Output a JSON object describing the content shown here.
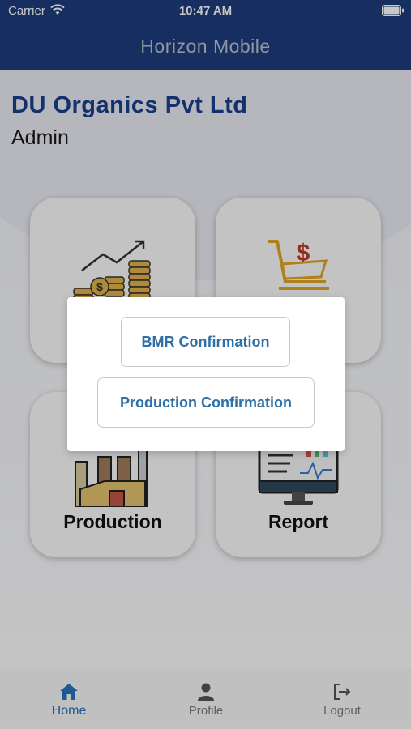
{
  "status_bar": {
    "carrier": "Carrier",
    "time": "10:47 AM"
  },
  "header": {
    "title": "Horizon Mobile"
  },
  "company": {
    "name": "DU Organics Pvt Ltd",
    "role": "Admin"
  },
  "tiles": [
    {
      "label": "",
      "icon": "finance-chart-coins-icon"
    },
    {
      "label": "",
      "icon": "shopping-cart-dollar-icon"
    },
    {
      "label": "Production",
      "icon": "factory-icon"
    },
    {
      "label": "Report",
      "icon": "monitor-report-icon"
    }
  ],
  "dialog": {
    "options": [
      {
        "label": "BMR Confirmation"
      },
      {
        "label": "Production Confirmation"
      }
    ]
  },
  "tabbar": {
    "items": [
      {
        "label": "Home",
        "icon": "home-icon",
        "active": true
      },
      {
        "label": "Profile",
        "icon": "person-icon",
        "active": false
      },
      {
        "label": "Logout",
        "icon": "logout-icon",
        "active": false
      }
    ]
  },
  "colors": {
    "header_bg": "#1e3c7c",
    "company_text": "#1a3f8f",
    "active_tab": "#2a71bd",
    "dialog_button_text": "#2d6fa6"
  }
}
